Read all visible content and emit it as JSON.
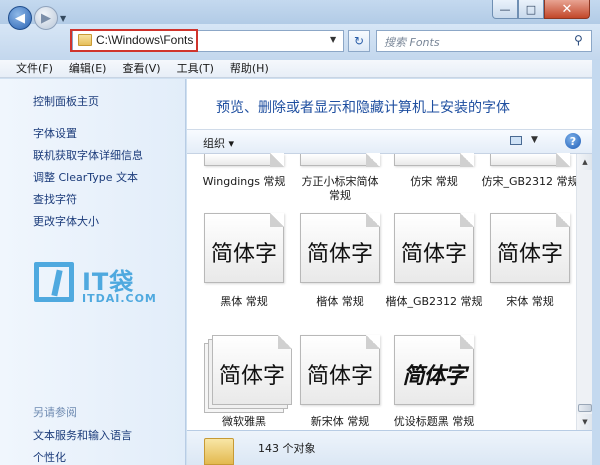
{
  "window": {
    "controls": {
      "minimize": "—",
      "maximize": "□",
      "close": "✕"
    }
  },
  "address_bar": {
    "path": "C:\\Windows\\Fonts",
    "search_placeholder": "搜索 Fonts"
  },
  "menu": [
    "文件(F)",
    "编辑(E)",
    "查看(V)",
    "工具(T)",
    "帮助(H)"
  ],
  "left_pane": {
    "links": [
      "控制面板主页",
      "字体设置",
      "联机获取字体详细信息",
      "调整 ClearType 文本",
      "查找字符",
      "更改字体大小"
    ],
    "see_also_title": "另请参阅",
    "see_also_links": [
      "文本服务和输入语言",
      "个性化"
    ],
    "watermark": {
      "brand": "IT袋",
      "site": "ITDAI.COM",
      "color": "#4fa9df"
    }
  },
  "main": {
    "heading": "预览、删除或者显示和隐藏计算机上安装的字体",
    "toolbar": {
      "organize": "组织 ▾"
    },
    "sample_text": "简体字",
    "fonts_row1": [
      "Wingdings 常规",
      "方正小标宋简体\n常规",
      "仿宋 常规",
      "仿宋_GB2312 常规"
    ],
    "fonts_row2": [
      "黑体 常规",
      "楷体 常规",
      "楷体_GB2312 常规",
      "宋体 常规"
    ],
    "fonts_row3": [
      "微软雅黑",
      "新宋体 常规",
      "优设标题黑 常规"
    ]
  },
  "details_pane": {
    "count_text": "143 个对象"
  },
  "colors": {
    "accent_link": "#1b3b7a",
    "heading": "#1f4fa0",
    "highlight_box": "#d0342c"
  }
}
